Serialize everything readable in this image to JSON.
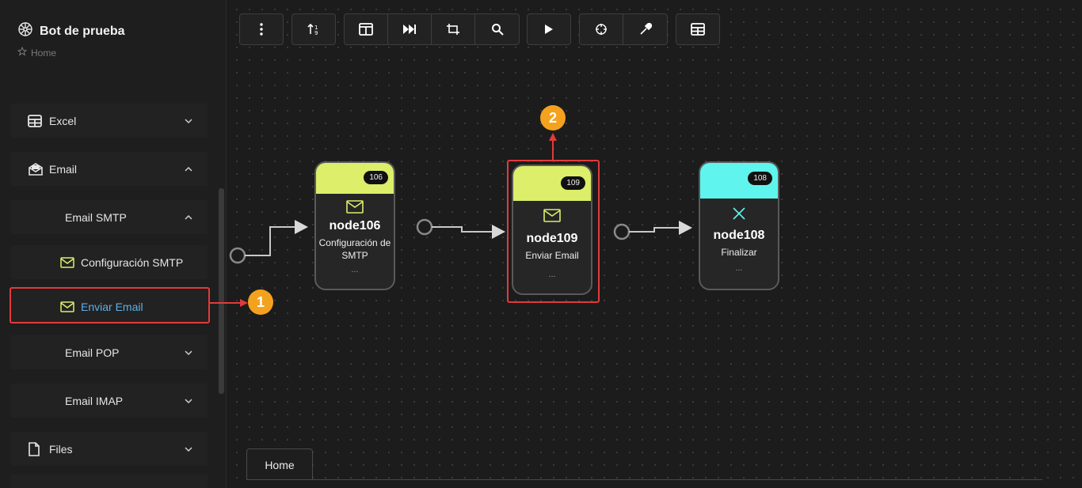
{
  "sidebar": {
    "bot_title": "Bot de prueba",
    "breadcrumb": "Home",
    "items": [
      {
        "label": "Excel"
      },
      {
        "label": "Email"
      },
      {
        "label": "Email SMTP"
      },
      {
        "label": "Configuración SMTP"
      },
      {
        "label": "Enviar Email"
      },
      {
        "label": "Email POP"
      },
      {
        "label": "Email IMAP"
      },
      {
        "label": "Files"
      }
    ]
  },
  "toolbar": {
    "icons": [
      "more-vertical-icon",
      "sort-icon",
      "layout-icon",
      "skip-forward-icon",
      "frame-icon",
      "search-icon",
      "play-icon",
      "target-icon",
      "eyedropper-icon",
      "table-icon"
    ]
  },
  "nodes": [
    {
      "id": "106",
      "name": "node106",
      "desc": "Configuración de SMTP",
      "more": "...",
      "color": "#dcee6a"
    },
    {
      "id": "109",
      "name": "node109",
      "desc": "Enviar Email",
      "more": "...",
      "color": "#dcee6a"
    },
    {
      "id": "108",
      "name": "node108",
      "desc": "Finalizar",
      "more": "...",
      "color": "#5ff5ee"
    }
  ],
  "annotations": {
    "step1": "1",
    "step2": "2",
    "highlight_color": "#e23a3a",
    "badge_color": "#f4a21e"
  },
  "tabs": [
    {
      "label": "Home"
    }
  ]
}
